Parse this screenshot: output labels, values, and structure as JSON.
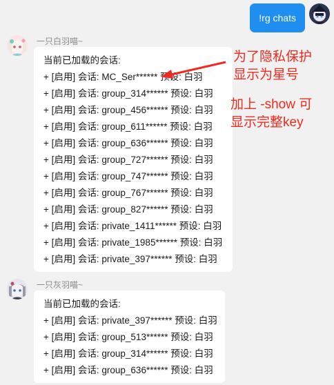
{
  "user_message": {
    "text": "!rg chats"
  },
  "messages": [
    {
      "sender": "一只白羽喵~",
      "header": "当前已加载的会话:",
      "lines": [
        "+ [启用] 会话: MC_Ser****** 预设: 白羽",
        "+ [启用] 会话: group_314****** 预设: 白羽",
        "+ [启用] 会话: group_456****** 预设: 白羽",
        "+ [启用] 会话: group_611****** 预设: 白羽",
        "+ [启用] 会话: group_636****** 预设: 白羽",
        "+ [启用] 会话: group_727****** 预设: 白羽",
        "+ [启用] 会话: group_747****** 预设: 白羽",
        "+ [启用] 会话: group_767****** 预设: 白羽",
        "+ [启用] 会话: group_827****** 预设: 白羽",
        "+ [启用] 会话: private_1411****** 预设: 白羽",
        "+ [启用] 会话: private_1985****** 预设: 白羽",
        "+ [启用] 会话: private_397****** 预设: 白羽"
      ]
    },
    {
      "sender": "一只灰羽喵~",
      "header": "当前已加载的会话:",
      "lines": [
        "+ [启用] 会话: private_397****** 预设: 白羽",
        "+ [启用] 会话: group_513****** 预设: 白羽",
        "+ [启用] 会话: group_314****** 预设: 白羽",
        "+ [启用] 会话: group_636****** 预设: 白羽"
      ]
    }
  ],
  "annotations": {
    "note1_line1": "为了隐私保护",
    "note1_line2": "显示为星号",
    "note2_line1": "加上 -show 可",
    "note2_line2": "显示完整key",
    "color": "#f02a1e"
  },
  "colors": {
    "background": "#f1f1f1",
    "user_bubble": "#1f8ef1",
    "bot_bubble": "#ffffff",
    "sender_name": "#8a8a8a"
  },
  "icons": {
    "user_avatar": "anime-avatar-dark",
    "bot1_avatar": "anime-avatar-white-hair",
    "bot2_avatar": "anime-avatar-grey-hair",
    "annotation_arrow": "red-arrow-left"
  }
}
